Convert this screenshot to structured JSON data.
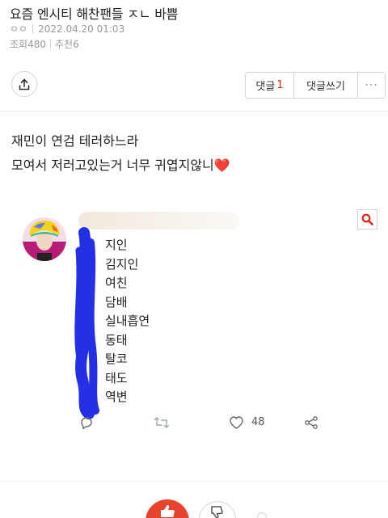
{
  "post": {
    "title": "요즘 엔시티 해찬팬들 ㅈㄴ 바쁨",
    "author": "ㅇㅇ",
    "date": "2022.04.20 01:03",
    "views_label": "조회480",
    "recommend_label": "추천6",
    "body_lines": [
      "재민이 연검 테러하느라",
      "모여서 저러고있는거 너무 귀엽지않니"
    ],
    "body_emoji": "❤️"
  },
  "toolbar": {
    "comment_label": "댓글",
    "comment_count": "1",
    "write_comment_label": "댓글쓰기",
    "more_label": "···"
  },
  "embed": {
    "words": [
      "지인",
      "김지인",
      "여친",
      "담배",
      "실내흡연",
      "동태",
      "탈코",
      "태도",
      "역변"
    ],
    "like_count": "48"
  },
  "colors": {
    "accent_red": "#e0251b",
    "like_button": "#e8432d",
    "scribble_blue": "#2430e6"
  },
  "icons": {
    "share": "share-icon",
    "search": "search-icon",
    "reply": "reply-icon",
    "retweet": "retweet-icon",
    "like": "heart-icon",
    "tweet_share": "tweet-share-icon",
    "thumbs_up": "thumbs-up-icon",
    "thumbs_down": "thumbs-down-icon"
  }
}
